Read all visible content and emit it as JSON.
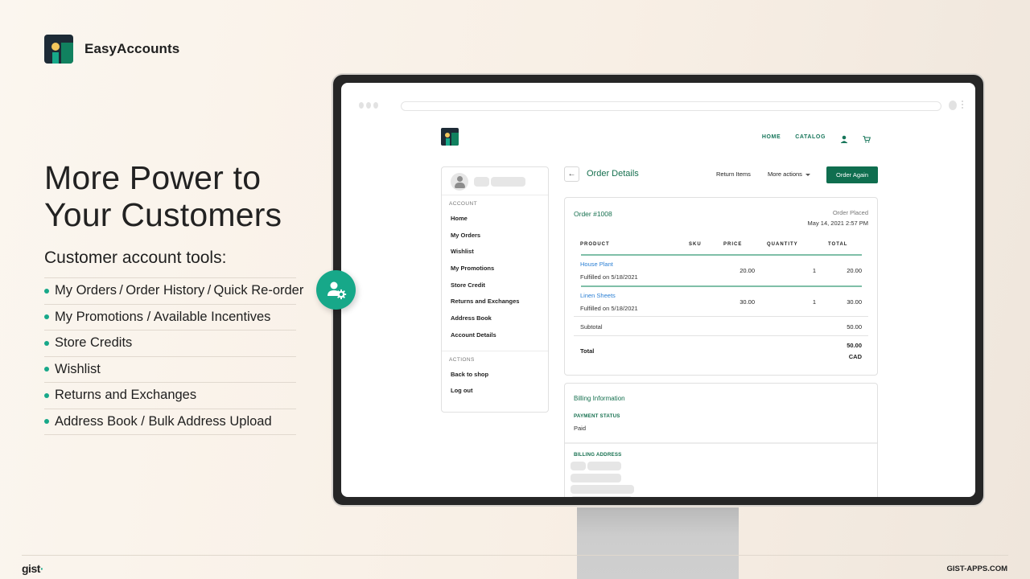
{
  "brand": {
    "name": "EasyAccounts"
  },
  "headline": {
    "line1": "More Power to",
    "line2": "Your Customers"
  },
  "subhead": "Customer account tools:",
  "features": [
    "My Orders / Order History / Quick Re-order",
    "My Promotions / Available Incentives",
    "Store Credits",
    "Wishlist",
    "Returns and Exchanges",
    "Address Book / Bulk Address Upload"
  ],
  "badge": {
    "icon": "user-settings-icon"
  },
  "store": {
    "nav": {
      "home": "HOME",
      "catalog": "CATALOG",
      "account_icon": "user-icon",
      "cart_icon": "cart-icon"
    }
  },
  "sidebar": {
    "account_title": "ACCOUNT",
    "account_items": [
      "Home",
      "My Orders",
      "Wishlist",
      "My Promotions",
      "Store Credit",
      "Returns and Exchanges",
      "Address Book",
      "Account Details"
    ],
    "actions_title": "ACTIONS",
    "action_items": [
      "Back to shop",
      "Log out"
    ]
  },
  "page": {
    "title": "Order Details",
    "back_icon": "←",
    "return_items": "Return Items",
    "more_actions": "More actions",
    "order_again": "Order Again"
  },
  "order": {
    "number": "Order #1008",
    "placed_label": "Order Placed",
    "placed_date": "May 14, 2021 2:57 PM",
    "columns": [
      "PRODUCT",
      "SKU",
      "PRICE",
      "QUANTITY",
      "TOTAL"
    ],
    "items": [
      {
        "name": "House Plant",
        "status": "Fulfilled on 5/18/2021",
        "sku": "",
        "price": "20.00",
        "quantity": "1",
        "total": "20.00"
      },
      {
        "name": "Linen Sheets",
        "status": "Fulfilled on 5/18/2021",
        "sku": "",
        "price": "30.00",
        "quantity": "1",
        "total": "30.00"
      }
    ],
    "subtotal_label": "Subtotal",
    "subtotal": "50.00",
    "total_label": "Total",
    "total": "50.00",
    "currency": "CAD"
  },
  "billing": {
    "title": "Billing Information",
    "payment_status_label": "PAYMENT STATUS",
    "payment_status": "Paid",
    "billing_address_label": "BILLING ADDRESS"
  },
  "footer": {
    "logo": "gist",
    "site": "GIST-APPS.COM"
  }
}
